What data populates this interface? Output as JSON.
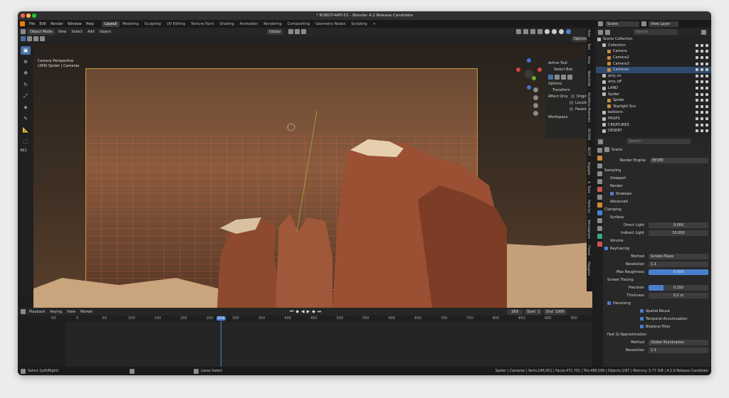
{
  "window": {
    "title": "* ROBOT-AMY-51 - Blender 4.2 Release Candidate"
  },
  "menu": [
    "File",
    "Edit",
    "Render",
    "Window",
    "Help"
  ],
  "workspaces": [
    "Layout",
    "Modeling",
    "Sculpting",
    "UV Editing",
    "Texture Paint",
    "Shading",
    "Animation",
    "Rendering",
    "Compositing",
    "Geometry Nodes",
    "Scripting"
  ],
  "scene": {
    "name": "Scene",
    "view_layer": "View Layer"
  },
  "viewport": {
    "mode": "Object Mode",
    "menus": [
      "View",
      "Select",
      "Add",
      "Object"
    ],
    "orientation": "Global",
    "options": "Options",
    "info_line1": "Camera Perspective",
    "info_line2": "(269) Spider | Cameras",
    "collection_tab": "AE2",
    "tabs": [
      "Item",
      "Tool",
      "View",
      "Sketchfab",
      "Realtime Materials",
      "BY-GEN",
      "BCDT",
      "Bagapie",
      "A. Tools",
      "Particles",
      "Atmosphere",
      "Flared",
      "Polygons"
    ]
  },
  "active_tool": {
    "header": "Active Tool",
    "tool": "Select Box",
    "options_header": "Options",
    "transform": "Transform",
    "affect_only": "Affect Only",
    "origins": "Origins",
    "locations": "Locations",
    "parents": "Parents",
    "workspace": "Workspace"
  },
  "timeline": {
    "menus": [
      "Playback",
      "Keying",
      "View",
      "Marker"
    ],
    "current_frame": "269",
    "start_label": "Start",
    "start": "1",
    "end_label": "End",
    "end": "1000",
    "ticks": [
      "-50",
      "0",
      "50",
      "100",
      "150",
      "200",
      "250",
      "269",
      "300",
      "350",
      "400",
      "450",
      "500",
      "550",
      "600",
      "650",
      "700",
      "750",
      "800",
      "850",
      "900",
      "950",
      "1000"
    ]
  },
  "status": {
    "left1": "Select (Left/Right)",
    "left2": "Lasso Select",
    "right": "Spider | Cameras | Verts:248,951 | Faces:471,701 | Tris:489,599 | Objects:1/87 | Memory: 5.77 GiB | 4.2.0 Release Candidate"
  },
  "outliner": {
    "search_placeholder": "Search",
    "rows": [
      {
        "label": "Scene Collection",
        "indent": 0,
        "sel": false
      },
      {
        "label": "Collection",
        "indent": 1,
        "sel": false
      },
      {
        "label": "Camera",
        "indent": 2,
        "sel": false
      },
      {
        "label": "Camera2",
        "indent": 2,
        "sel": false
      },
      {
        "label": "Camera3",
        "indent": 2,
        "sel": false
      },
      {
        "label": "Cameras",
        "indent": 2,
        "sel": true
      },
      {
        "label": "amy on",
        "indent": 1,
        "sel": false
      },
      {
        "label": "amy off",
        "indent": 1,
        "sel": false
      },
      {
        "label": "LAND",
        "indent": 1,
        "sel": false
      },
      {
        "label": "Spider",
        "indent": 1,
        "sel": false
      },
      {
        "label": "Spider",
        "indent": 2,
        "sel": false
      },
      {
        "label": "Starlight Sun",
        "indent": 2,
        "sel": false
      },
      {
        "label": "balloons",
        "indent": 1,
        "sel": false
      },
      {
        "label": "PROPS",
        "indent": 1,
        "sel": false
      },
      {
        "label": "CREATURES",
        "indent": 1,
        "sel": false
      },
      {
        "label": "DESERT",
        "indent": 1,
        "sel": false
      }
    ]
  },
  "properties": {
    "search_placeholder": "Search",
    "scene_label": "Scene",
    "render_engine_label": "Render Engine",
    "render_engine": "EEVEE",
    "sampling": "Sampling",
    "viewport": "Viewport",
    "render": "Render",
    "shadows": "Shadows",
    "advanced": "Advanced",
    "clamping": "Clamping",
    "surface": "Surface",
    "direct_light_label": "Direct Light",
    "direct_light": "0.000",
    "indirect_light_label": "Indirect Light",
    "indirect_light": "10.000",
    "volume": "Volume",
    "raytracing": "Raytracing",
    "method_label": "Method",
    "method": "Screen-Trace",
    "resolution_label": "Resolution",
    "resolution": "1:1",
    "max_roughness_label": "Max Roughness",
    "max_roughness": "0.500",
    "screen_tracing": "Screen Tracing",
    "precision_label": "Precision",
    "precision": "0.250",
    "thickness_label": "Thickness",
    "thickness": "0.2 m",
    "denoising": "Denoising",
    "spatial_reuse": "Spatial Reuse",
    "temporal_accumulation": "Temporal Accumulation",
    "bilateral_filter": "Bilateral Filter",
    "fast_gi": "Fast GI Approximation",
    "gi_method": "Global Illumination",
    "gi_resolution": "1:1"
  }
}
